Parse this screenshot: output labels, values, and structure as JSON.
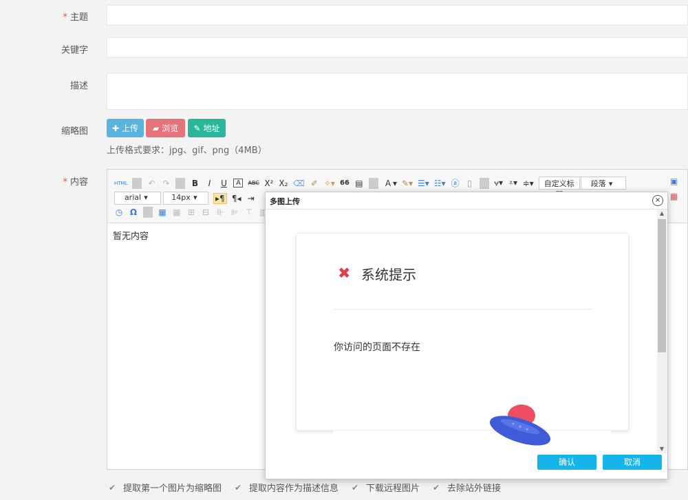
{
  "form": {
    "subject_label": "主题",
    "keywords_label": "关键字",
    "description_label": "描述",
    "thumbnail_label": "缩略图",
    "content_label": "内容",
    "required_mark": "*",
    "upload_btn": "上传",
    "browse_btn": "浏览",
    "address_btn": "地址",
    "upload_hint": "上传格式要求：jpg、gif、png（4MB）"
  },
  "editor": {
    "font_family": "arial",
    "font_size": "14px",
    "custom_title": "自定义标题",
    "paragraph": "段落",
    "html_btn": "HTML",
    "bold": "B",
    "italic": "I",
    "underline": "U",
    "strike": "ABC",
    "superscript": "X²",
    "subscript": "X₂",
    "quote": "66",
    "font_color": "A",
    "omega": "Ω",
    "content": "暂无内容"
  },
  "options": [
    "提取第一个图片为缩略图",
    "提取内容作为描述信息",
    "下载远程图片",
    "去除站外链接"
  ],
  "dialog": {
    "title": "多图上传",
    "close": "×",
    "notice_title": "系统提示",
    "notice_msg": "你访问的页面不存在",
    "ok": "确认",
    "cancel": "取消"
  },
  "colors": {
    "upload": "#5bb3e0",
    "browse": "#e4747a",
    "address": "#2bb59a",
    "dialog_button": "#13b5ea",
    "error": "#e03f47"
  }
}
